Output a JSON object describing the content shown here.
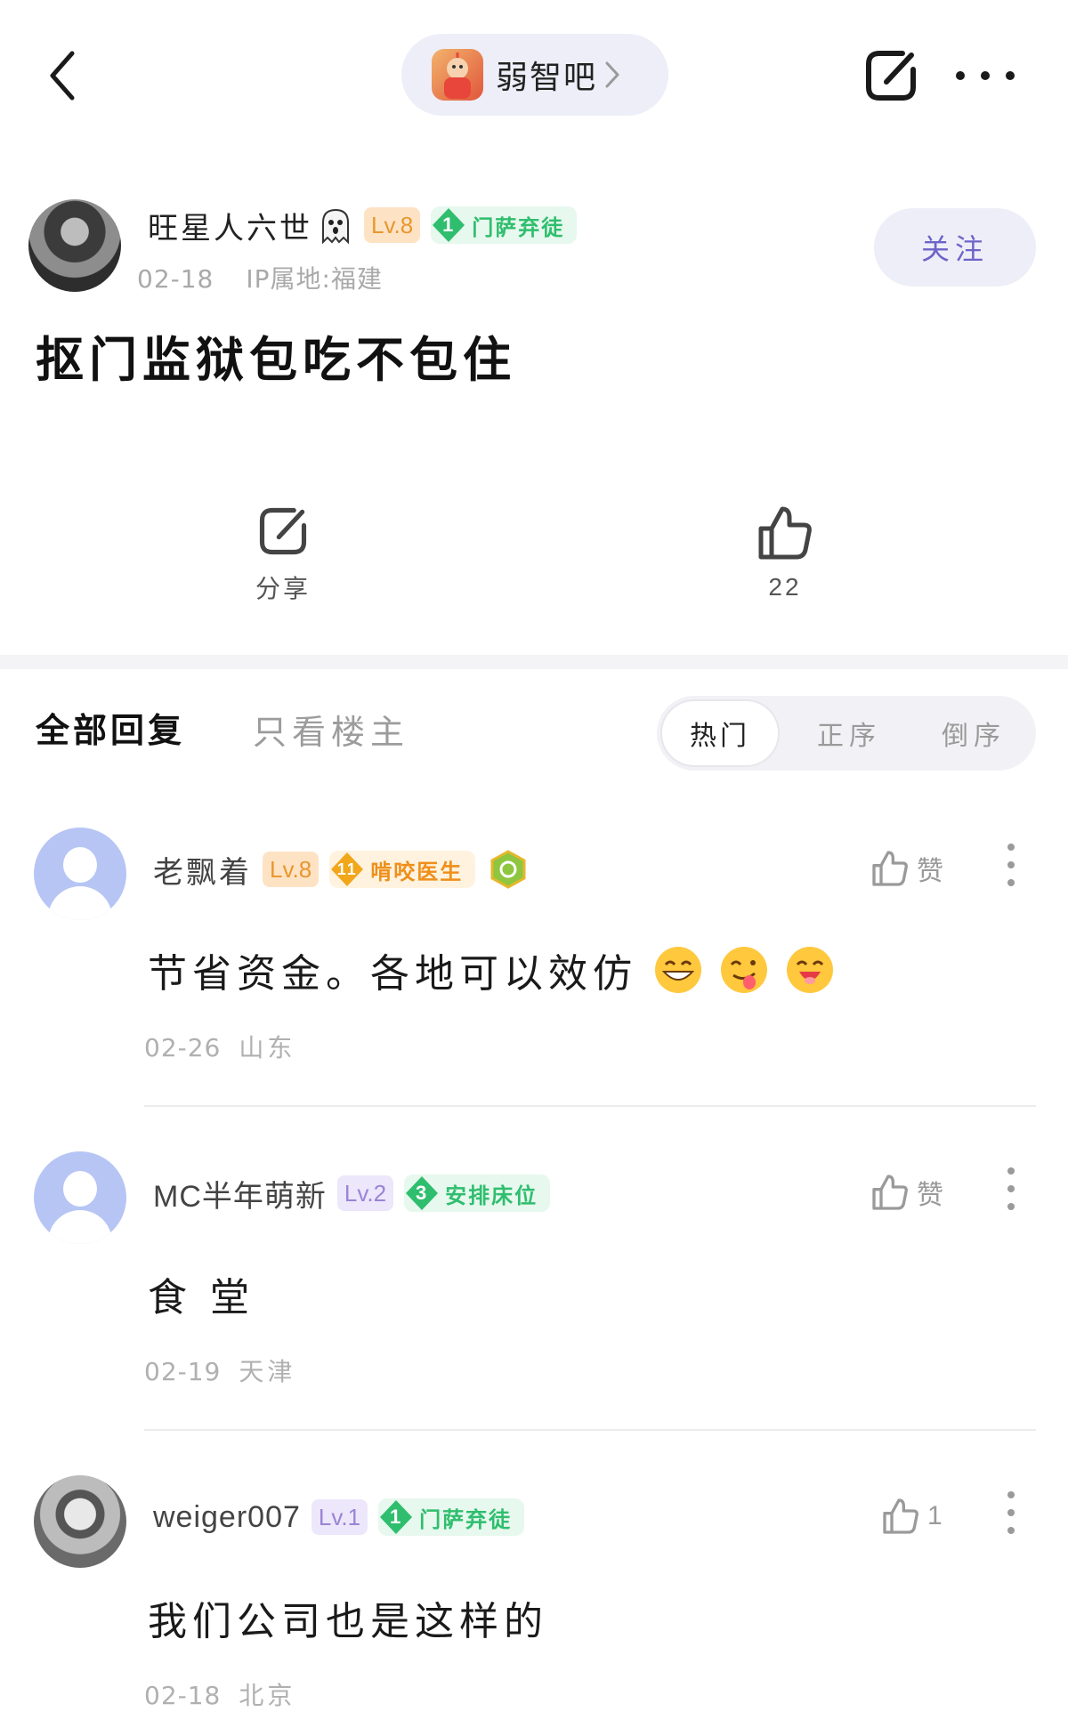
{
  "topbar": {
    "forum_name": "弱智吧"
  },
  "post": {
    "author": {
      "name": "旺星人六世",
      "level": "Lv.8",
      "tag_num": "1",
      "tag_text": "门萨弃徒"
    },
    "date": "02-18",
    "ip": "IP属地:福建",
    "follow_label": "关注",
    "title": "抠门监狱包吃不包住",
    "share_label": "分享",
    "like_count": "22"
  },
  "replies": {
    "tab_all": "全部回复",
    "tab_op": "只看楼主",
    "sort": [
      "热门",
      "正序",
      "倒序"
    ]
  },
  "comments": [
    {
      "name": "老飘着",
      "level": "Lv.8",
      "tag_num": "11",
      "tag_text": "啃咬医生",
      "text": "节省资金。各地可以效仿",
      "date": "02-26",
      "location": "山东",
      "like_label": "赞"
    },
    {
      "name": "MC半年萌新",
      "level": "Lv.2",
      "tag_num": "3",
      "tag_text": "安排床位",
      "text": "食 堂",
      "date": "02-19",
      "location": "天津",
      "like_label": "赞"
    },
    {
      "name": "weiger007",
      "level": "Lv.1",
      "tag_num": "1",
      "tag_text": "门萨弃徒",
      "text": "我们公司也是这样的",
      "date": "02-18",
      "location": "北京",
      "like_label": "1"
    }
  ],
  "colors": {
    "accent": "#6d64c8",
    "pill_bg": "#eeeef8",
    "green_tag": "#2fbe6e",
    "orange_tag": "#ef8f1a",
    "meta_gray": "#a9a9a9"
  },
  "icons": {
    "back": "chevron-left-icon",
    "share": "share-icon",
    "more": "more-dots-icon",
    "like": "thumb-up-icon",
    "emoji": [
      "grin-emoji-icon",
      "yum-emoji-icon",
      "smile-emoji-icon"
    ]
  }
}
